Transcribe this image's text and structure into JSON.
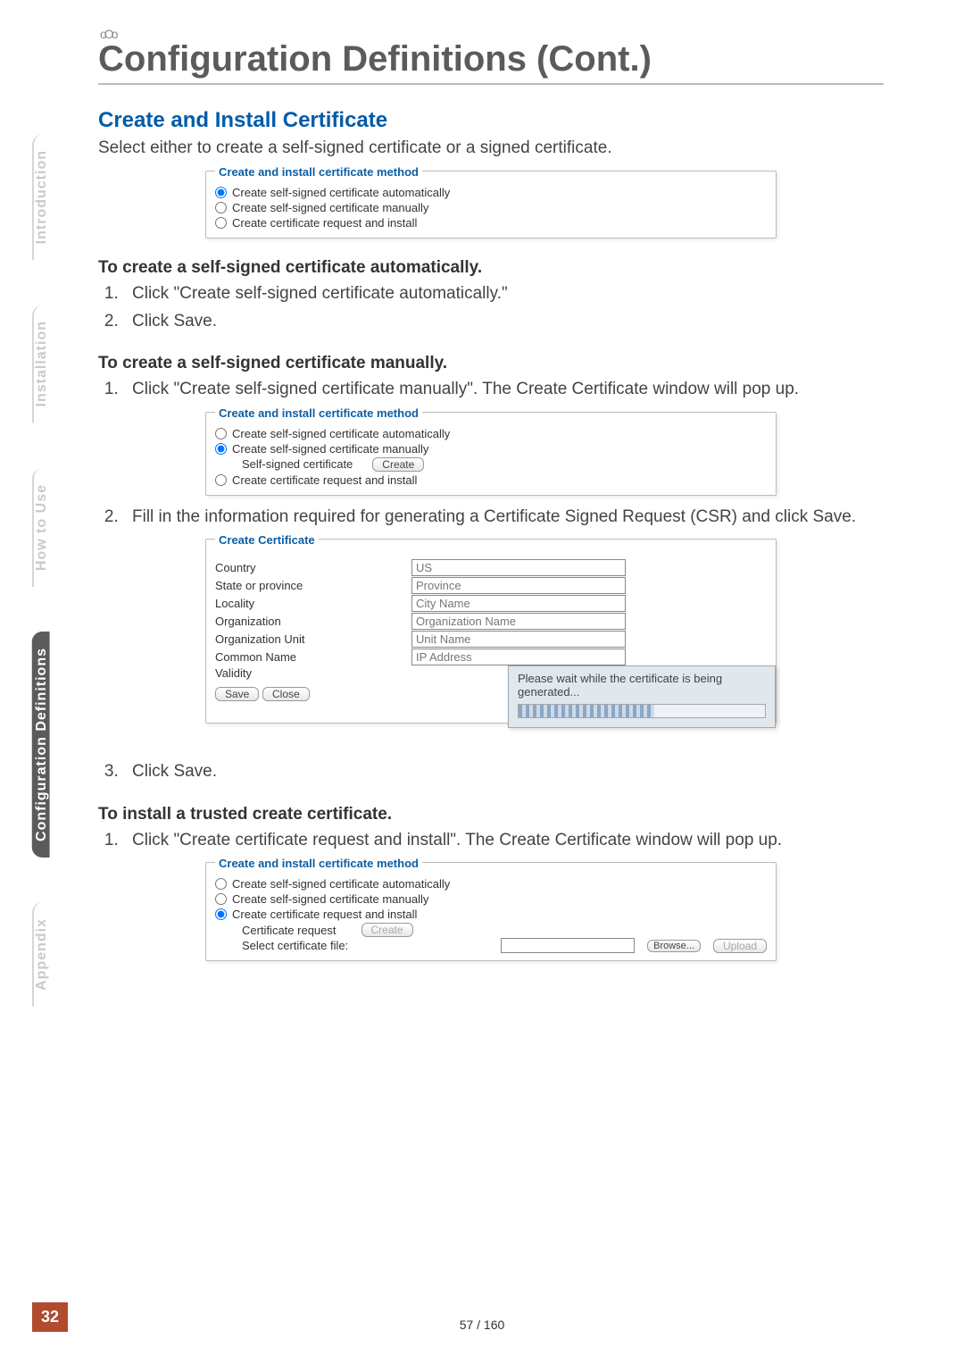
{
  "header": {
    "circles": "oOo",
    "title": "Configuration Definitions (Cont.)"
  },
  "sidenav": [
    "Introduction",
    "Installation",
    "How to Use",
    "Configuration Definitions",
    "Appendix"
  ],
  "section": {
    "heading": "Create and Install Certificate",
    "lead": "Select either to create a self-signed certificate or a signed certificate."
  },
  "shot1": {
    "legend": "Create and install certificate method",
    "opts": [
      "Create self-signed certificate automatically",
      "Create self-signed certificate manually",
      "Create certificate request and install"
    ]
  },
  "auto": {
    "heading": "To create a self-signed certificate automatically.",
    "steps": [
      "Click \"Create self-signed certificate automatically.\"",
      "Click Save."
    ]
  },
  "manual": {
    "heading": "To create a self-signed certificate manually.",
    "step1": "Click \"Create self-signed certificate manually\". The Create Certificate window will pop up.",
    "step2": "Fill in the information required for generating a Certificate Signed Request (CSR) and click Save.",
    "step3": "Click Save."
  },
  "shot2": {
    "legend": "Create and install certificate method",
    "opts": [
      "Create self-signed certificate automatically",
      "Create self-signed certificate manually",
      "Create certificate request and install"
    ],
    "subLabel": "Self-signed certificate",
    "createBtn": "Create"
  },
  "shot_form": {
    "legend": "Create Certificate",
    "rows": [
      {
        "lbl": "Country",
        "val": "US"
      },
      {
        "lbl": "State or province",
        "val": "Province"
      },
      {
        "lbl": "Locality",
        "val": "City Name"
      },
      {
        "lbl": "Organization",
        "val": "Organization Name"
      },
      {
        "lbl": "Organization Unit",
        "val": "Unit Name"
      },
      {
        "lbl": "Common Name",
        "val": "IP Address"
      },
      {
        "lbl": "Validity",
        "val": ""
      }
    ],
    "saveBtn": "Save",
    "closeBtn": "Close",
    "overlay": "Please wait while the certificate is being generated..."
  },
  "install": {
    "heading": "To install a trusted create certificate.",
    "step1": "Click \"Create certificate request and install\". The Create Certificate window will pop up."
  },
  "shot3": {
    "legend": "Create and install certificate method",
    "opts": [
      "Create self-signed certificate automatically",
      "Create self-signed certificate manually",
      "Create certificate request and install"
    ],
    "certReqLabel": "Certificate request",
    "createBtn": "Create",
    "selectFileLabel": "Select certificate file:",
    "browseBtn": "Browse...",
    "uploadBtn": "Upload"
  },
  "footer": {
    "pageBox": "32",
    "pdfPage": "57 / 160"
  }
}
